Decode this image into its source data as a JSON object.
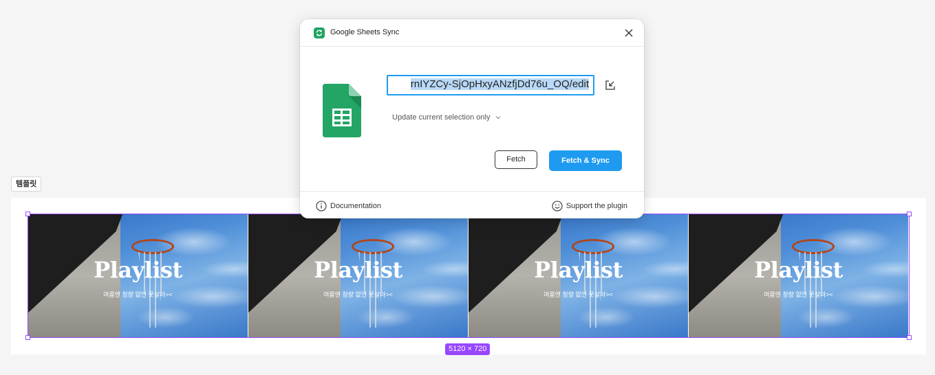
{
  "canvas": {
    "frame_label": "템플릿",
    "size_badge": "5120 × 720",
    "selection_color": "#9747ff",
    "slides": [
      {
        "title": "Playlist",
        "subtitle": "여름엔 청량 없인 못살아>< "
      },
      {
        "title": "Playlist",
        "subtitle": "여름엔 청량 없인 못살아>< "
      },
      {
        "title": "Playlist",
        "subtitle": "여름엔 청량 없인 못살아>< "
      },
      {
        "title": "Playlist",
        "subtitle": "여름엔 청량 없인 못살아>< "
      }
    ]
  },
  "dialog": {
    "title": "Google Sheets Sync",
    "app_icon": "sync-icon",
    "close_icon": "close-icon",
    "logo": "google-sheets-logo",
    "url_value": "rnIYZCy-SjOpHxyANzfjDd76u_OQ/edit",
    "url_action_icon": "open-external-icon",
    "mode_selected": "Update current selection only",
    "fetch_label": "Fetch",
    "sync_label": "Fetch & Sync",
    "accent_color": "#1e9bf0",
    "footer": {
      "documentation_label": "Documentation",
      "documentation_icon": "info-icon",
      "support_label": "Support the plugin",
      "support_icon": "smile-icon"
    }
  }
}
